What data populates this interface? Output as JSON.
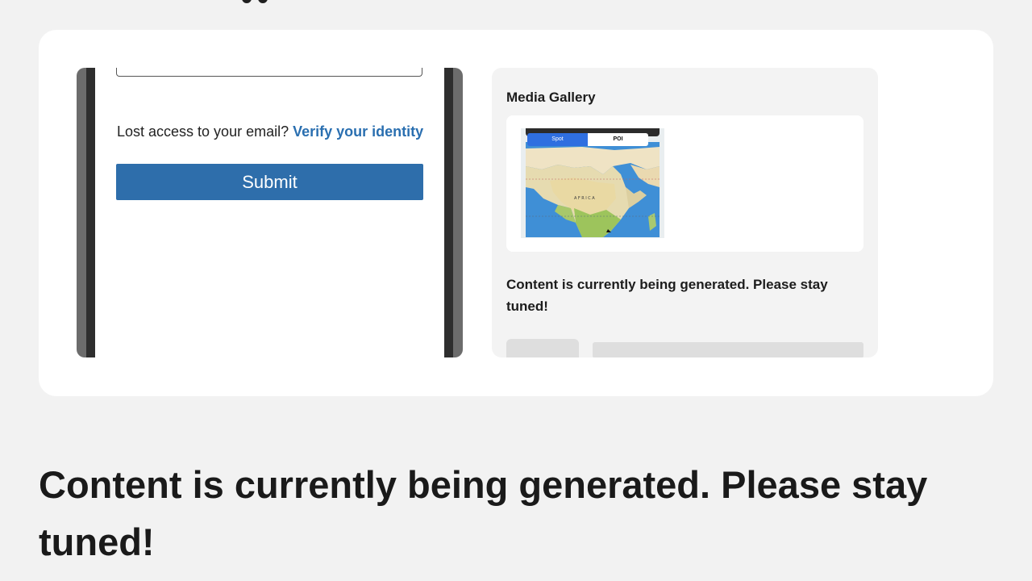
{
  "phone": {
    "lost_access_text": "Lost access to your email?",
    "verify_link": "Verify your identity",
    "submit_label": "Submit"
  },
  "gallery": {
    "title": "Media Gallery",
    "thumbnail": {
      "segment_left": "Spot",
      "segment_right": "POI",
      "map_label": "AFRICA"
    },
    "status": "Content is currently being generated. Please stay tuned!"
  },
  "main": {
    "status": "Content is currently being generated. Please stay tuned!"
  },
  "colors": {
    "accent": "#2e6eab",
    "link": "#2a6fb0",
    "background": "#f2f2f2",
    "card": "#ffffff"
  }
}
